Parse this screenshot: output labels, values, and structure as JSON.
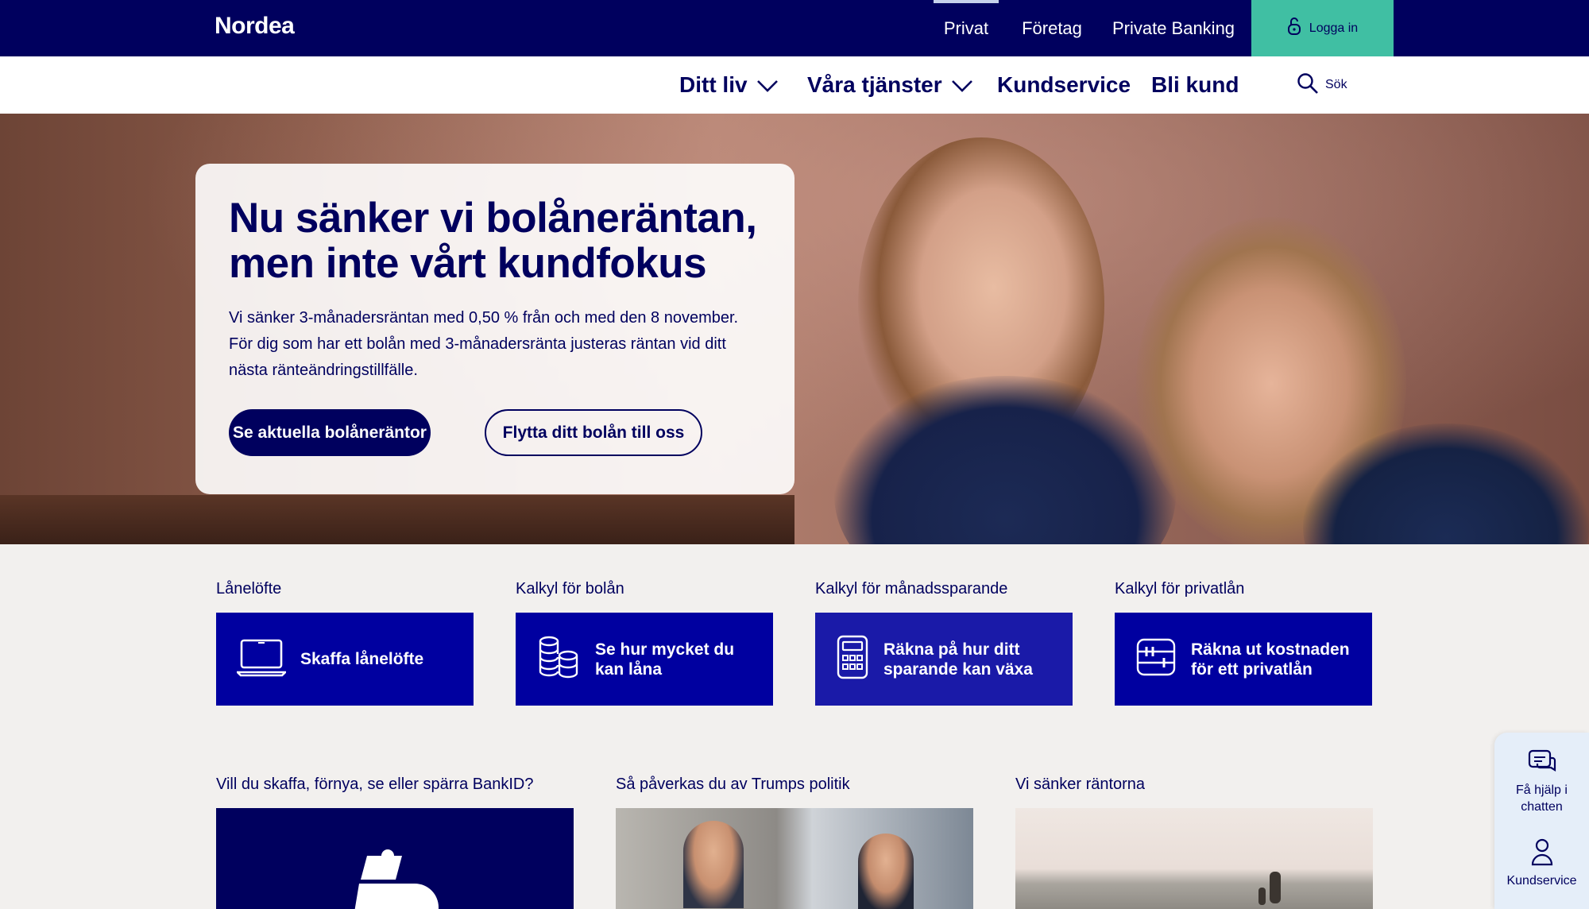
{
  "topbar": {
    "logo": "Nordea",
    "segments": [
      "Privat",
      "Företag",
      "Private Banking"
    ],
    "active_segment": "Privat",
    "login_label": "Logga in",
    "login_icon": "lock-icon",
    "bg_color": "#00005e",
    "login_color": "#40bfa3"
  },
  "nav": {
    "items": [
      {
        "label": "Ditt liv",
        "has_dropdown": true
      },
      {
        "label": "Våra tjänster",
        "has_dropdown": true
      },
      {
        "label": "Kundservice",
        "has_dropdown": false
      },
      {
        "label": "Bli kund",
        "has_dropdown": false
      }
    ],
    "search_label": "Sök",
    "search_icon": "search-icon"
  },
  "hero": {
    "title": "Nu sänker vi bolåneräntan, men inte vårt kundfokus",
    "body": "Vi sänker 3-månadersräntan med 0,50 % från och med den 8 november. För dig som har ett bolån med 3-månadersränta justeras räntan vid ditt nästa ränteändringstillfälle.",
    "primary_button": "Se aktuella bolåneräntor",
    "secondary_button": "Flytta ditt bolån till oss"
  },
  "quick_links": [
    {
      "label": "Lånelöfte",
      "button": "Skaffa lånelöfte",
      "icon": "laptop-icon"
    },
    {
      "label": "Kalkyl för bolån",
      "button": "Se hur mycket du kan låna",
      "icon": "coins-icon"
    },
    {
      "label": "Kalkyl för månadssparande",
      "button": "Räkna på hur ditt sparande kan växa",
      "icon": "calculator-icon"
    },
    {
      "label": "Kalkyl för privatlån",
      "button": "Räkna ut kostnaden för ett privatlån",
      "icon": "abacus-icon"
    }
  ],
  "articles": [
    {
      "label": "Vill du skaffa, förnya, se eller spärra BankID?",
      "image": "bankid-logo"
    },
    {
      "label": "Så påverkas du av Trumps politik",
      "image": "two-men-portraits"
    },
    {
      "label": "Vi sänker räntorna",
      "image": "beach-family"
    }
  ],
  "chat_widget": {
    "chat_label": "Få hjälp i chatten",
    "chat_icon": "chat-bubbles-icon",
    "service_label": "Kundservice",
    "service_icon": "person-icon"
  }
}
